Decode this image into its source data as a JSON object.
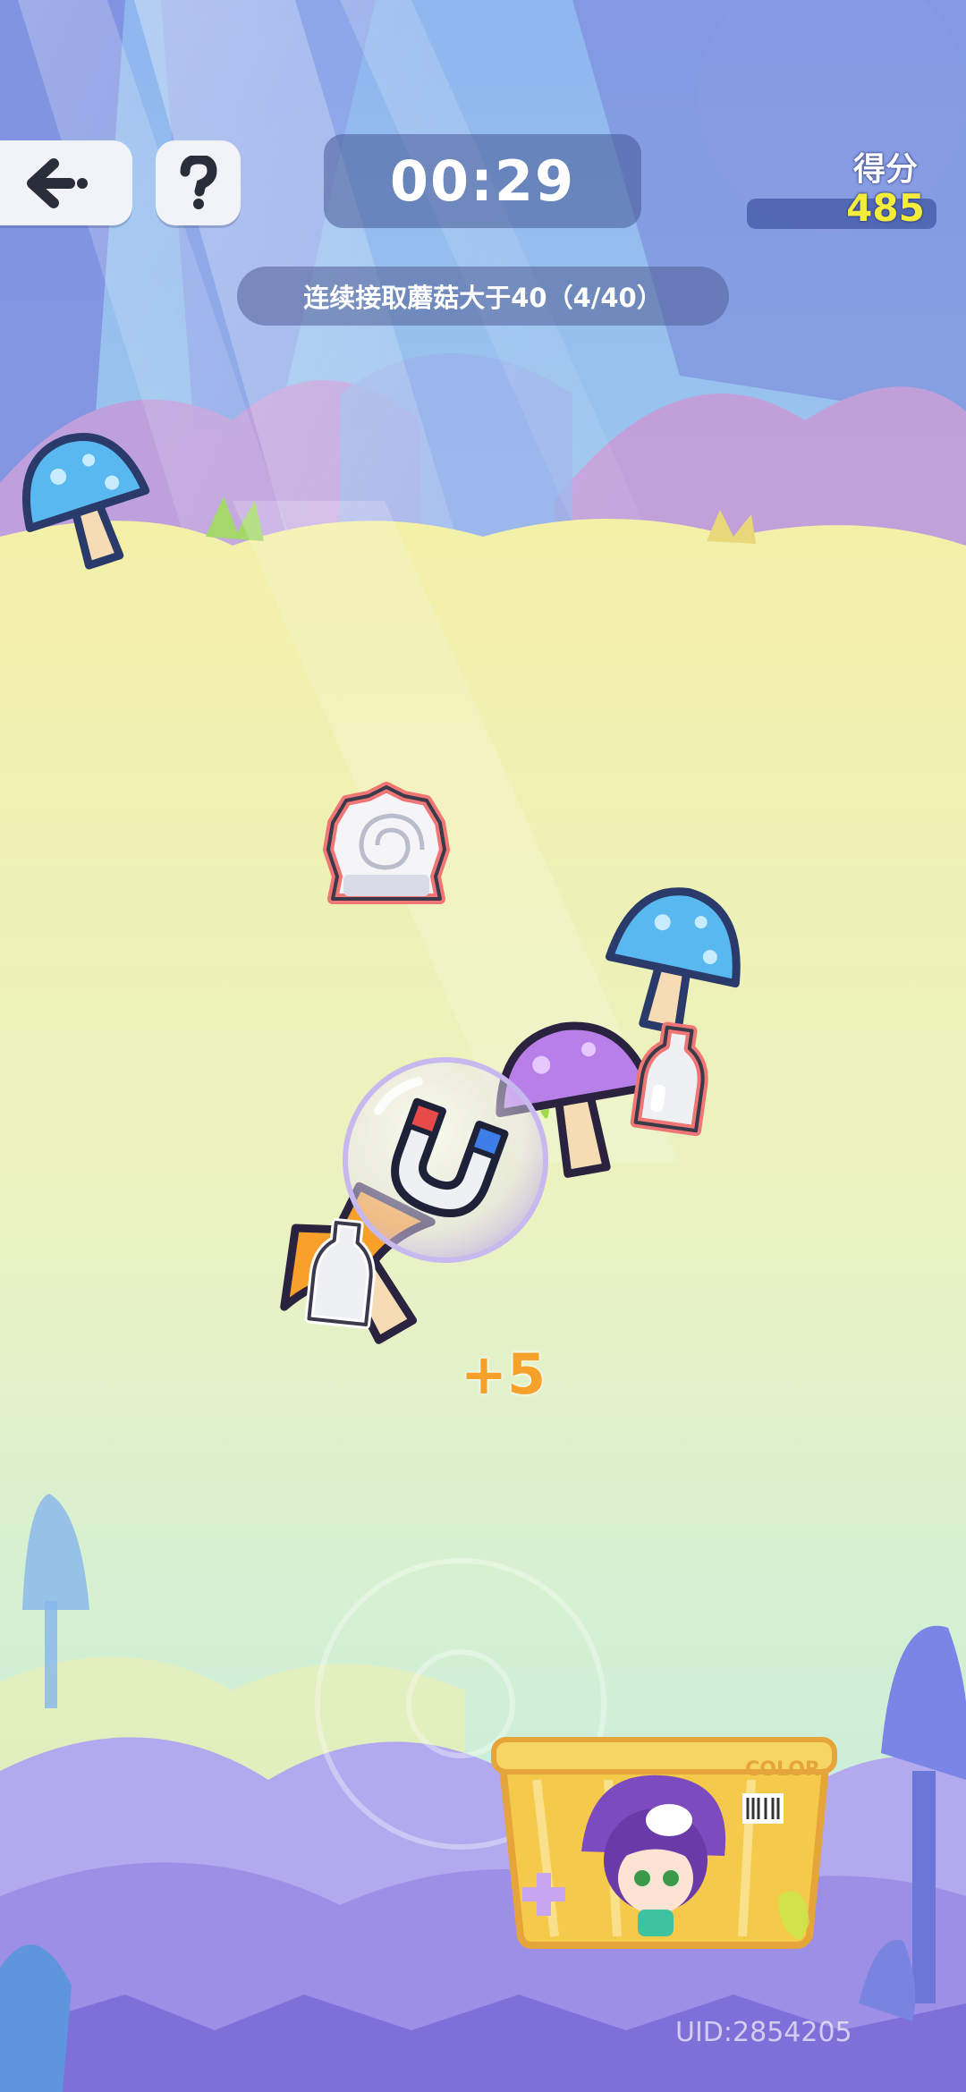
{
  "hud": {
    "back_icon": "back-arrow-icon",
    "help_icon": "question-mark-icon",
    "timer": "00:29",
    "task": "连续接取蘑菇大于40（4/40）",
    "score_label": "得分",
    "score_value": "485"
  },
  "effects": {
    "score_popup": "+5"
  },
  "basket": {
    "brand": "COLOR"
  },
  "footer": {
    "uid": "UID:2854205"
  },
  "colors": {
    "blue_mushroom": "#5ab8f0",
    "purple_mushroom": "#b97fe8",
    "orange_mushroom": "#f8a02a",
    "bottle_outline": "#f07676",
    "basket": "#f5c94a",
    "score_text": "#f4ec3a",
    "popup_text": "#f5a12a"
  }
}
